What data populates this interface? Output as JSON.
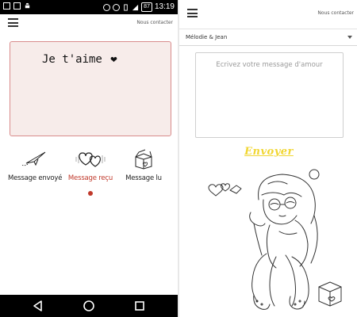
{
  "left": {
    "status_bar": {
      "icons_left": [
        "photo-icon",
        "image-icon",
        "android-icon"
      ],
      "icons_right": [
        "no-disturb-icon",
        "alarm-icon",
        "vibrate-icon",
        "signal-icon",
        "battery-icon"
      ],
      "battery": "87",
      "time": "13:19"
    },
    "header": {
      "contact_label": "Nous contacter"
    },
    "message_card": {
      "text": "Je t'aime",
      "heart": "❤"
    },
    "tabs": [
      {
        "label": "Message envoyé",
        "icon": "paper-plane-icon",
        "active": false
      },
      {
        "label": "Message reçu",
        "icon": "two-hearts-icon",
        "active": true
      },
      {
        "label": "Message lu",
        "icon": "open-box-icon",
        "active": false
      }
    ],
    "nav": [
      "back-icon",
      "home-icon",
      "recents-icon"
    ]
  },
  "right": {
    "header": {
      "contact_label": "Nous contacter"
    },
    "recipient_select": {
      "value": "Mélodie & Jean"
    },
    "message_input": {
      "placeholder": "Ecrivez votre message d'amour"
    },
    "send_label": "Envoyer",
    "illustration": "sad-girl-with-hearts-illustration"
  },
  "colors": {
    "accent_red": "#c0392b",
    "card_border": "#d98c8c",
    "card_fill": "#f7ecea",
    "send_yellow": "#f1d632"
  }
}
